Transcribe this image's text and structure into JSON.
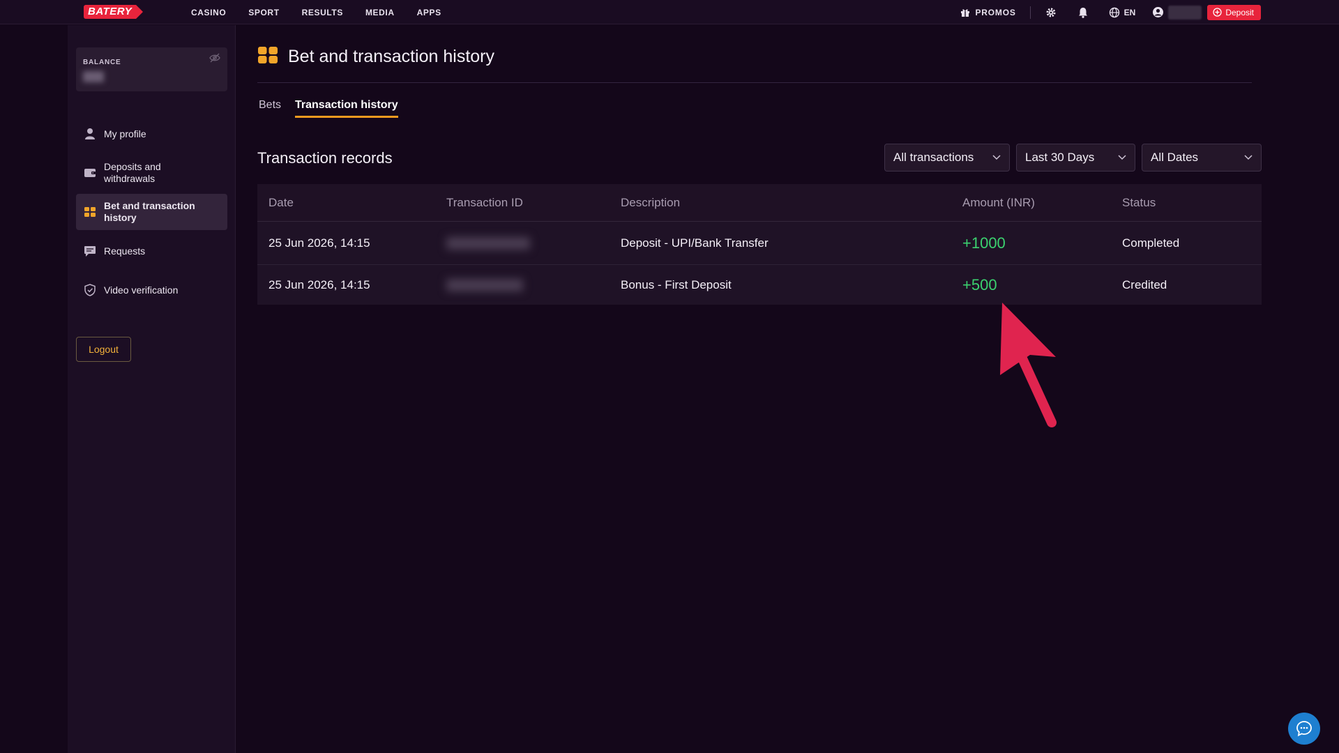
{
  "brand": {
    "logo_text": "BATERY",
    "accent": "#e8243c"
  },
  "nav": {
    "items": [
      {
        "label": "CASINO"
      },
      {
        "label": "SPORT"
      },
      {
        "label": "RESULTS"
      },
      {
        "label": "MEDIA"
      },
      {
        "label": "APPS"
      }
    ]
  },
  "top_right": {
    "promos_label": "PROMOS",
    "lang_label": "EN",
    "deposit_label": "Deposit"
  },
  "sidebar": {
    "balance_label": "BALANCE",
    "items": [
      {
        "label": "My profile",
        "icon": "user-icon"
      },
      {
        "label": "Deposits and withdrawals",
        "icon": "wallet-icon"
      },
      {
        "label": "Bet and transaction history",
        "icon": "ticket-icon",
        "active": true
      },
      {
        "label": "Requests",
        "icon": "chat-icon"
      },
      {
        "label": "Video verification",
        "icon": "shield-icon"
      }
    ],
    "logout_label": "Logout"
  },
  "main": {
    "title": "Bet and transaction history",
    "tabs": [
      {
        "label": "Bets"
      },
      {
        "label": "Transaction history",
        "active": true
      }
    ],
    "section_title": "Transaction records",
    "filters": {
      "type": "All transactions",
      "period": "Last 30 Days",
      "dates": "All Dates"
    },
    "table": {
      "headers": [
        "Date",
        "Transaction ID",
        "Description",
        "Amount (INR)",
        "Status"
      ],
      "rows": [
        {
          "date": "25 Jun 2026, 14:15",
          "description": "Deposit - UPI/Bank Transfer",
          "amount": "+1000",
          "status": "Completed"
        },
        {
          "date": "25 Jun 2026, 14:15",
          "description": "Bonus - First Deposit",
          "amount": "+500",
          "status": "Credited"
        }
      ]
    }
  },
  "colors": {
    "background": "#14071a",
    "positive_amount": "#3bd16f",
    "tab_underline": "#f29a1f",
    "annotation_arrow": "#e0244f",
    "chat_button": "#1e7fd0"
  }
}
